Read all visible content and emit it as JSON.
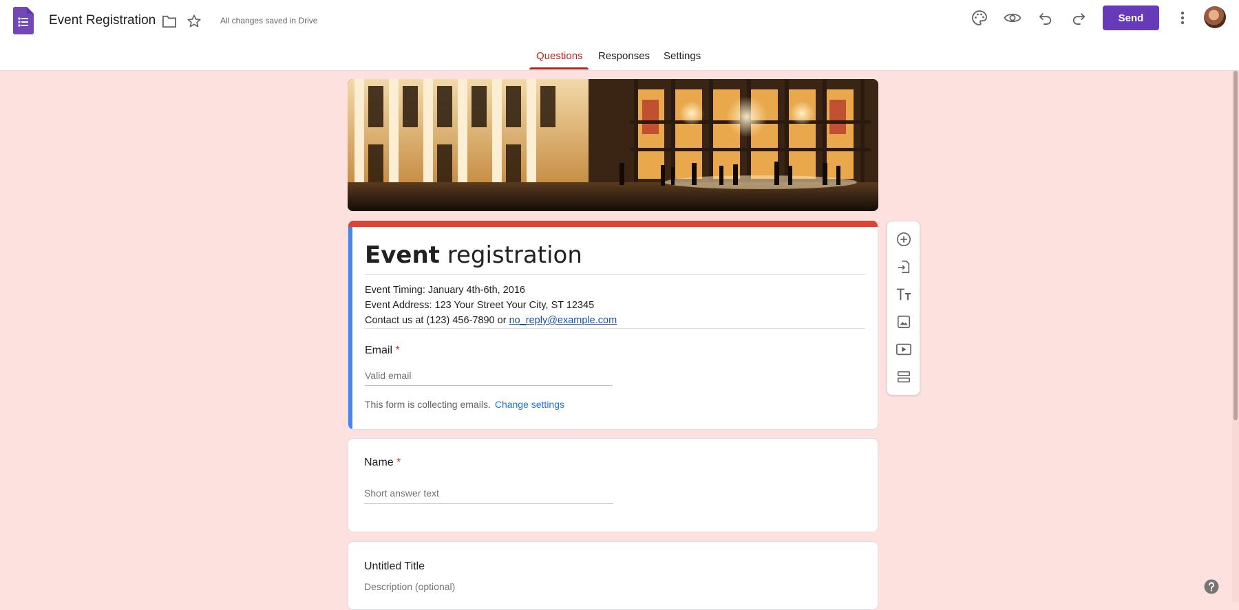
{
  "header": {
    "doc_title": "Event Registration",
    "save_status": "All changes saved in Drive",
    "send_label": "Send",
    "icons": [
      "forms-logo-icon",
      "folder-icon",
      "star-icon",
      "palette-icon",
      "preview-eye-icon",
      "undo-icon",
      "redo-icon",
      "more-vert-icon",
      "avatar"
    ]
  },
  "tabs": [
    {
      "label": "Questions",
      "active": true
    },
    {
      "label": "Responses",
      "active": false
    },
    {
      "label": "Settings",
      "active": false
    }
  ],
  "form": {
    "title_bold": "Event",
    "title_rest": " registration",
    "description": [
      "Event Timing: January 4th-6th, 2016",
      "Event Address: 123 Your Street Your City, ST 12345",
      "Contact us at (123) 456-7890 or "
    ],
    "contact_email": "no_reply@example.com",
    "email_question": {
      "label": "Email",
      "required_mark": "*",
      "placeholder": "Valid email",
      "collect_note": "This form is collecting emails.",
      "change_settings": "Change settings"
    },
    "name_question": {
      "label": "Name",
      "required_mark": "*",
      "placeholder": "Short answer text"
    },
    "untitled_question": {
      "title": "Untitled Title",
      "description_placeholder": "Description (optional)"
    }
  },
  "side_toolbar": [
    "add-question-icon",
    "import-questions-icon",
    "add-title-icon",
    "add-image-icon",
    "add-video-icon",
    "add-section-icon"
  ],
  "colors": {
    "accent": "#673ab7",
    "page_bg": "#fce1de",
    "tab_active": "#b3261e",
    "title_top_bar": "#db4437",
    "title_left_bar": "#4285f4"
  }
}
